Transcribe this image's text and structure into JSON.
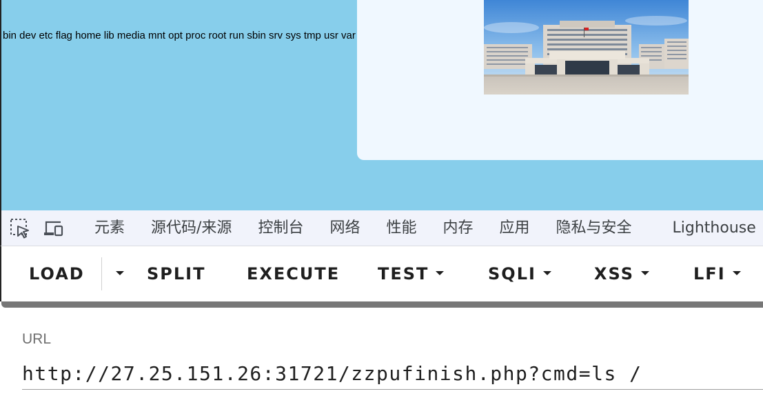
{
  "webpage": {
    "command_output": "bin dev etc flag home lib media mnt opt proc root run sbin srv sys tmp usr var",
    "background_color": "#87ceeb",
    "card_color": "#f0f8ff"
  },
  "devtools": {
    "icons": [
      "select-element-icon",
      "device-toolbar-icon"
    ],
    "tabs": [
      "元素",
      "源代码/来源",
      "控制台",
      "网络",
      "性能",
      "内存",
      "应用",
      "隐私与安全",
      "Lighthouse"
    ]
  },
  "hackbar": {
    "load": "LOAD",
    "split": "SPLIT",
    "execute": "EXECUTE",
    "test": "TEST",
    "sqli": "SQLI",
    "xss": "XSS",
    "lfi": "LFI"
  },
  "url_field": {
    "label": "URL",
    "value": "http://27.25.151.26:31721/zzpufinish.php?cmd=ls /"
  }
}
